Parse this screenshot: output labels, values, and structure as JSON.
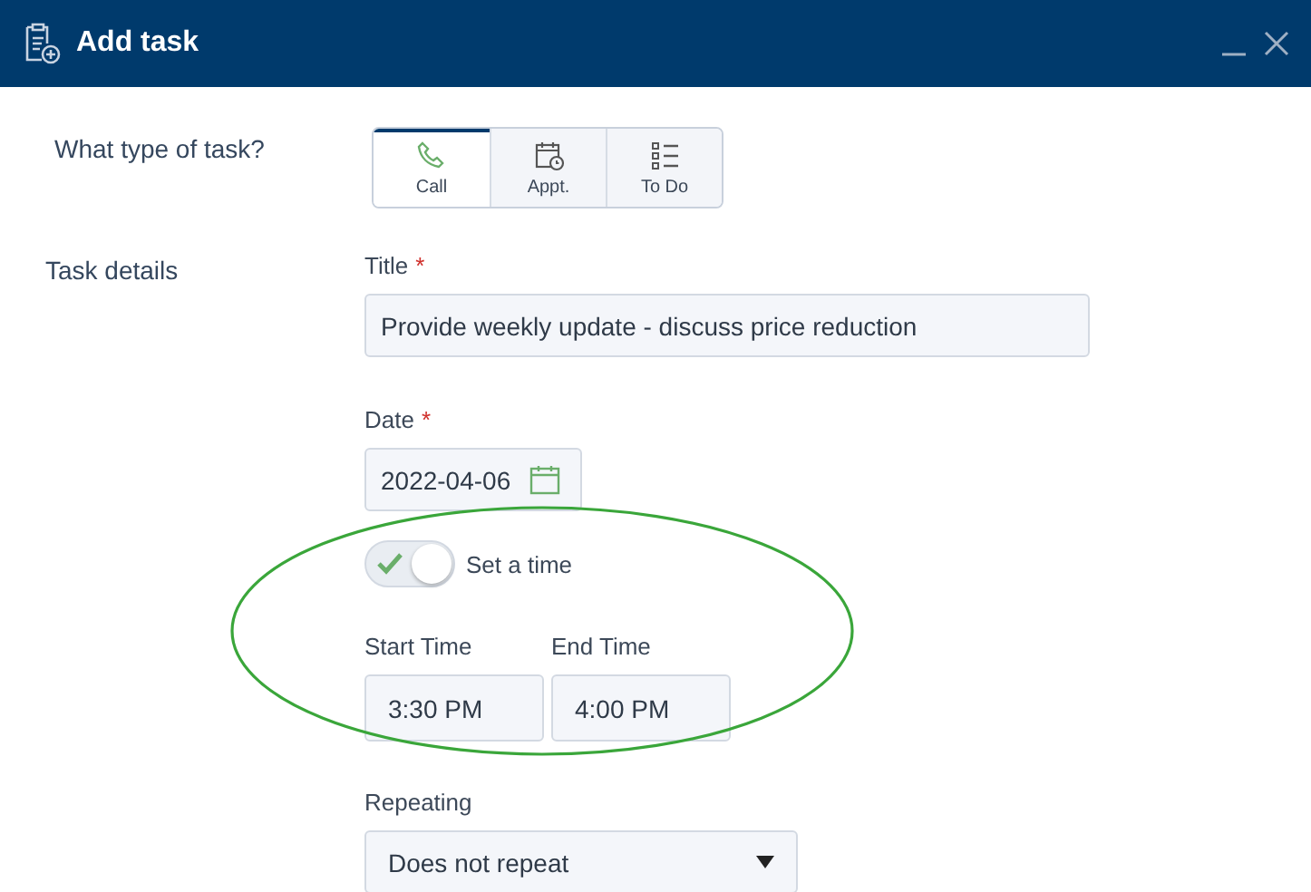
{
  "window": {
    "title": "Add task"
  },
  "task_type": {
    "label": "What type of task?",
    "options": [
      {
        "label": "Call",
        "kind": "phone",
        "selected": true
      },
      {
        "label": "Appt.",
        "kind": "calendar",
        "selected": false
      },
      {
        "label": "To Do",
        "kind": "list",
        "selected": false
      }
    ]
  },
  "section_label": "Task details",
  "title_field": {
    "label": "Title",
    "required_mark": "*",
    "value": "Provide weekly update - discuss price reduction"
  },
  "date_field": {
    "label": "Date",
    "required_mark": "*",
    "value": "2022-04-06"
  },
  "set_time": {
    "label": "Set a time",
    "on": true
  },
  "start_time": {
    "label": "Start Time",
    "value": "3:30 PM"
  },
  "end_time": {
    "label": "End Time",
    "value": "4:00 PM"
  },
  "repeating": {
    "label": "Repeating",
    "value": "Does not repeat"
  }
}
